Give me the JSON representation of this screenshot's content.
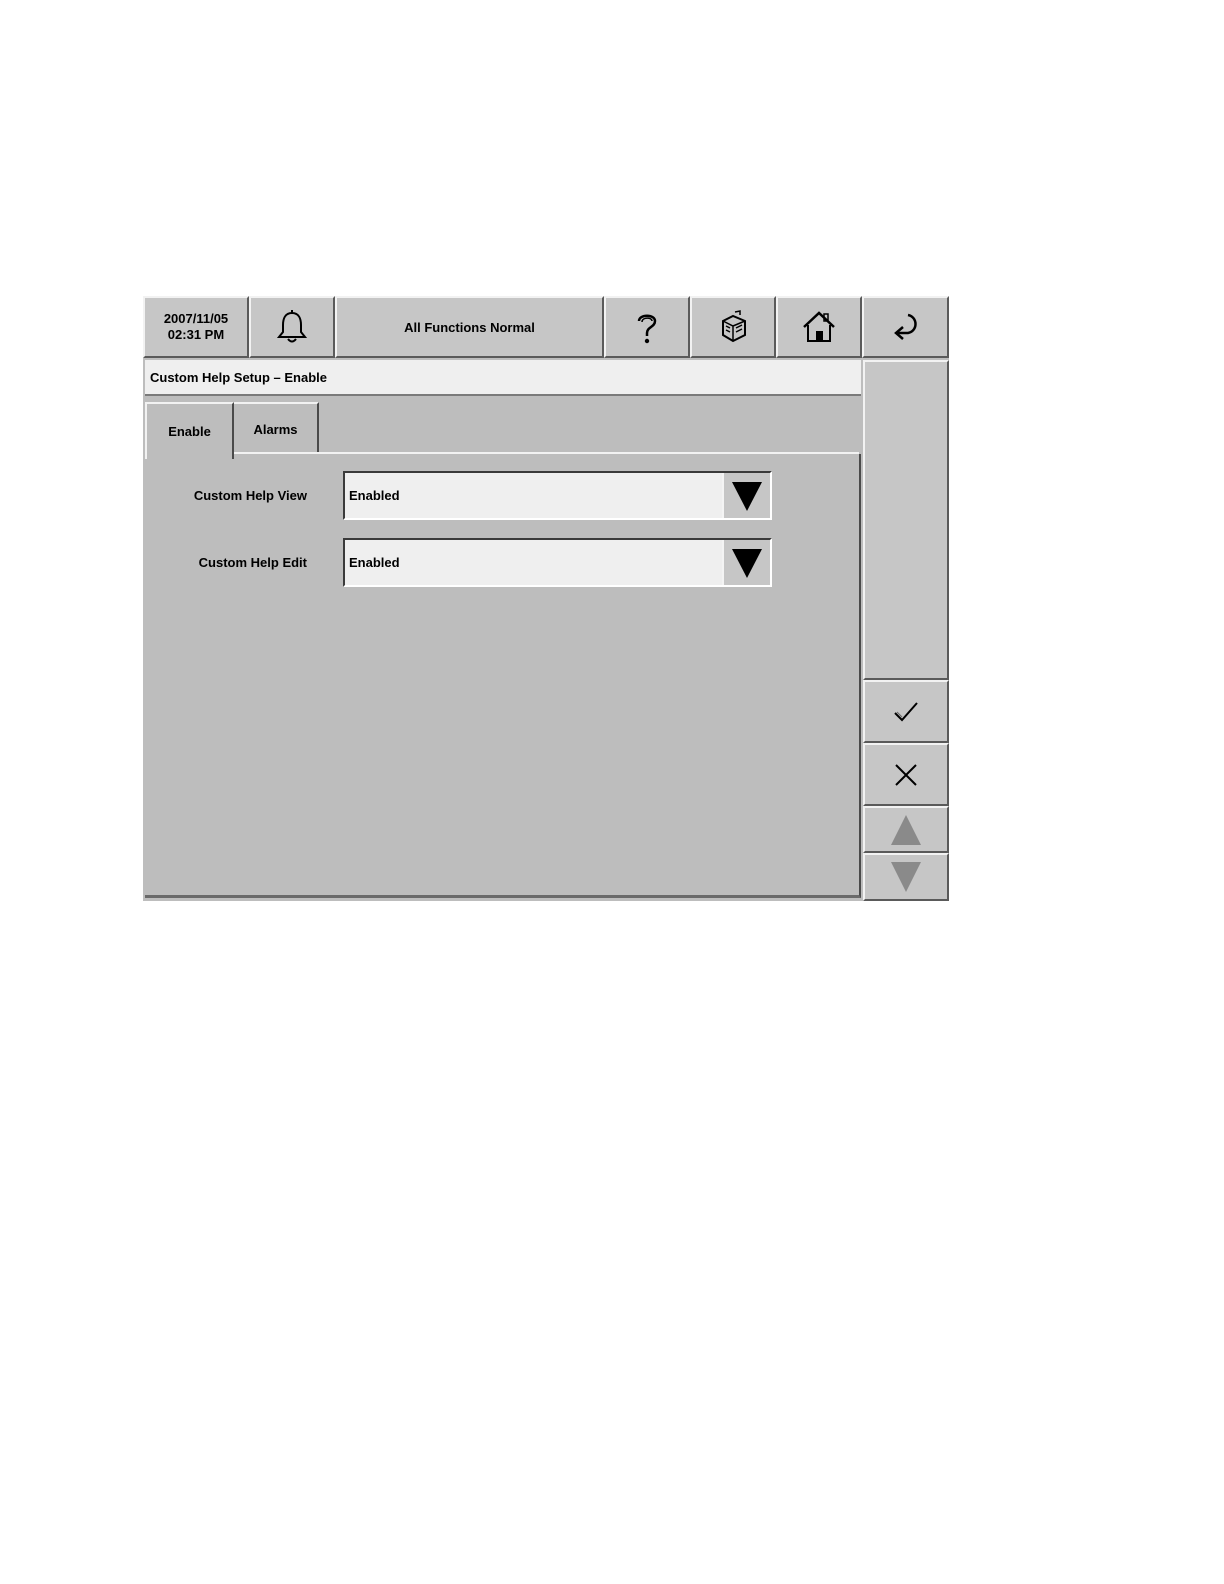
{
  "topbar": {
    "date": "2007/11/05",
    "time": "02:31 PM",
    "alarm_icon": "bell-icon",
    "status": "All Functions Normal",
    "help_icon": "question-mark-icon",
    "service_icon": "service-icon",
    "home_icon": "home-icon",
    "back_icon": "back-arrow-icon"
  },
  "header": {
    "title": "Custom Help Setup – Enable"
  },
  "tabs": [
    {
      "label": "Enable",
      "active": true
    },
    {
      "label": "Alarms",
      "active": false
    }
  ],
  "fields": [
    {
      "label": "Custom Help View",
      "value": "Enabled"
    },
    {
      "label": "Custom Help Edit",
      "value": "Enabled"
    }
  ],
  "sidebar": {
    "ok_icon": "checkmark-icon",
    "cancel_icon": "x-icon",
    "up_icon": "up-arrow-icon",
    "down_icon": "down-arrow-icon"
  }
}
